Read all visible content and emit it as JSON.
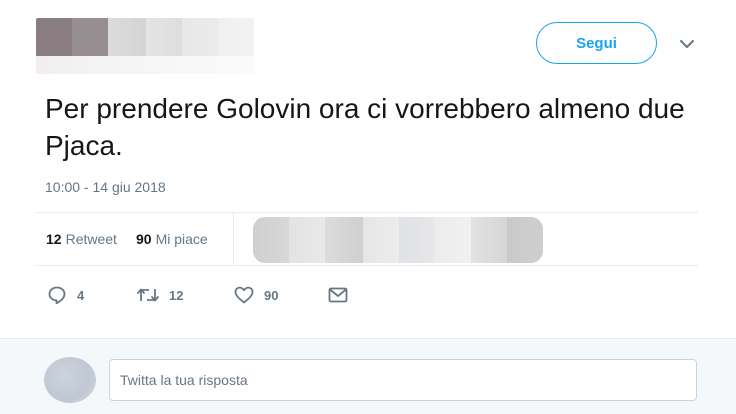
{
  "header": {
    "follow_label": "Segui"
  },
  "tweet": {
    "text": "Per prendere Golovin ora ci vorrebbero almeno due Pjaca.",
    "timestamp": "10:00 - 14 giu 2018"
  },
  "stats": {
    "retweets_count": "12",
    "retweets_label": "Retweet",
    "likes_count": "90",
    "likes_label": "Mi piace"
  },
  "actions": {
    "reply_count": "4",
    "retweet_count": "12",
    "like_count": "90",
    "icons": [
      "reply-icon",
      "retweet-icon",
      "heart-icon",
      "envelope-icon"
    ]
  },
  "reply": {
    "placeholder": "Twitta la tua risposta"
  },
  "colors": {
    "accent": "#1da1f2",
    "muted_text": "#657786",
    "border": "#e6ecf0",
    "reply_bar_bg": "#f5f8fa"
  }
}
